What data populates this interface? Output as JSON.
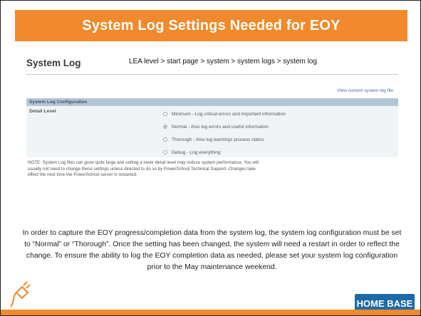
{
  "slide": {
    "title": "System Log Settings Needed for EOY"
  },
  "screen": {
    "heading": "System Log",
    "breadcrumb": "LEA level > start page > system > system logs > system log",
    "view_link": "View current system log file",
    "config_header": "System Log Configuration",
    "detail_level_label": "Detail Level",
    "options": [
      {
        "label": "Minimum - Log critical errors and important information",
        "checked": false
      },
      {
        "label": "Normal - Also log errors and useful information",
        "checked": true
      },
      {
        "label": "Thorough - Also log warnings process status",
        "checked": false
      },
      {
        "label": "Debug - Log everything",
        "checked": false
      }
    ],
    "note": "NOTE: System Log files can grow quite large and setting a lower detail level may reduce system performance. You will usually not need to change these settings unless directed to do so by PowerSchool Technical Support. Changes take effect the next time the PowerSchool server is restarted."
  },
  "body": {
    "text": "In order to capture the EOY progress/completion data from the system log, the system log configuration must be set to “Normal” or “Thorough”. Once the setting has been changed, the system will need a restart in order to reflect the change. To ensure the ability to log the EOY completion data as needed, please set your system log configuration prior to the May maintenance weekend."
  },
  "logo": {
    "text": "HOME BASE"
  },
  "colors": {
    "accent": "#f08a2c",
    "brand_blue": "#1d6aa8",
    "panel_header": "#b4c6d6"
  },
  "icons": {
    "plug": "plug-icon"
  }
}
